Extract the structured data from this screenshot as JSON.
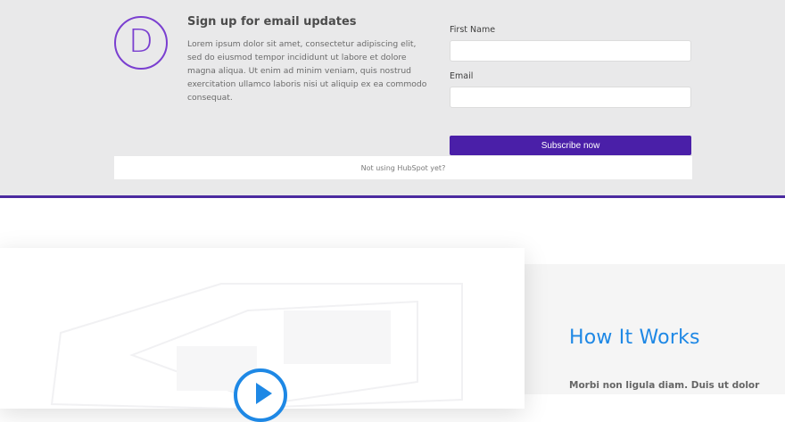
{
  "signup": {
    "logo_letter": "D",
    "title": "Sign up for email updates",
    "body": "Lorem ipsum dolor sit amet, consectetur adipiscing elit, sed do eiusmod tempor incididunt ut labore et dolore magna aliqua. Ut enim ad minim veniam, quis nostrud exercitation ullamco laboris nisi ut aliquip ex ea commodo consequat.",
    "first_name_label": "First Name",
    "first_name_value": "",
    "email_label": "Email",
    "email_value": "",
    "subscribe_label": "Subscribe now",
    "hubspot_text": "Not using HubSpot yet?"
  },
  "how": {
    "title": "How It Works",
    "body": "Morbi non ligula diam. Duis ut dolor"
  },
  "colors": {
    "accent_purple": "#4a1fa8",
    "logo_purple": "#7a3fd0",
    "link_blue": "#1e88e5"
  },
  "icons": {
    "logo": "divi-logo-icon",
    "play": "play-icon"
  }
}
